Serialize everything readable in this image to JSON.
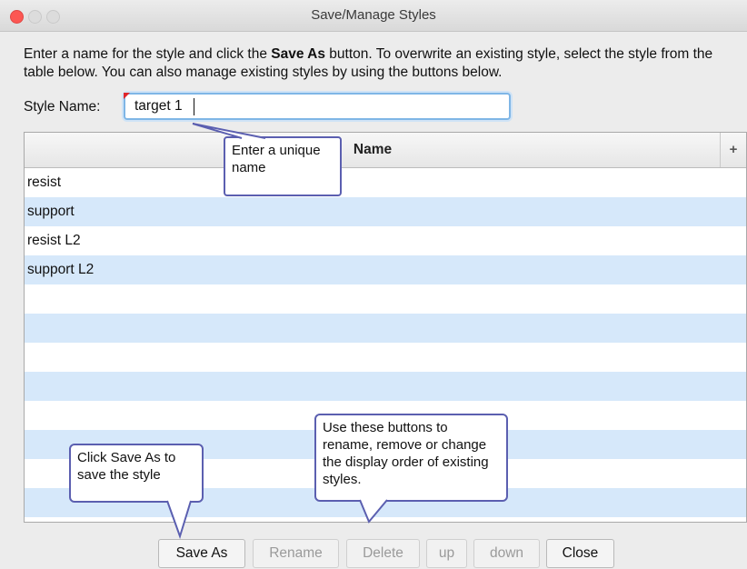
{
  "window": {
    "title": "Save/Manage Styles"
  },
  "instructions": {
    "part1": "Enter a name for the style and click the ",
    "bold": "Save As",
    "part2": " button.  To overwrite an existing style, select the style from the table below.  You can also manage existing styles by using the buttons below."
  },
  "style_name": {
    "label": "Style Name:",
    "value": "target 1"
  },
  "table": {
    "column_header": "Name",
    "add_glyph": "+",
    "rows": [
      "resist",
      "support",
      "resist L2",
      "support L2",
      "",
      "",
      "",
      "",
      "",
      "",
      "",
      ""
    ]
  },
  "buttons": {
    "save_as": "Save As",
    "rename": "Rename",
    "delete": "Delete",
    "up": "up",
    "down": "down",
    "close": "Close"
  },
  "callouts": {
    "name_hint": "Enter a unique name",
    "save_hint": "Click Save As to save the style",
    "manage_hint": "Use these buttons to rename, remove or change the display order of existing styles."
  },
  "colors": {
    "row_stripe": "#d6e8fa",
    "callout_border": "#5b5fb0",
    "input_focus": "#7fb6e6",
    "close_light": "#fc5753"
  }
}
